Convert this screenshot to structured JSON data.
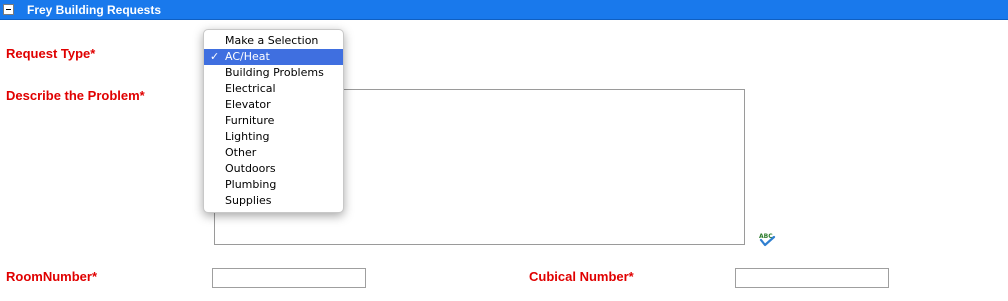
{
  "header": {
    "title": "Frey Building Requests",
    "collapse_icon": "minus-box-icon"
  },
  "form": {
    "request_type_label": "Request Type*",
    "describe_label": "Describe the Problem*",
    "room_label": "RoomNumber*",
    "cubical_label": "Cubical Number*",
    "describe_value": "",
    "room_value": "",
    "cubical_value": "",
    "spellcheck_icon": "abc-spellcheck-icon",
    "spellcheck_text": "ABC"
  },
  "dropdown": {
    "selected": "AC/Heat",
    "check_mark": "✓",
    "options": [
      "Make a Selection",
      "AC/Heat",
      "Building Problems",
      "Electrical",
      "Elevator",
      "Furniture",
      "Lighting",
      "Other",
      "Outdoors",
      "Plumbing",
      "Supplies"
    ]
  },
  "colors": {
    "header": "#1979ec",
    "label": "#e00000",
    "selection": "#3f6fe0"
  }
}
